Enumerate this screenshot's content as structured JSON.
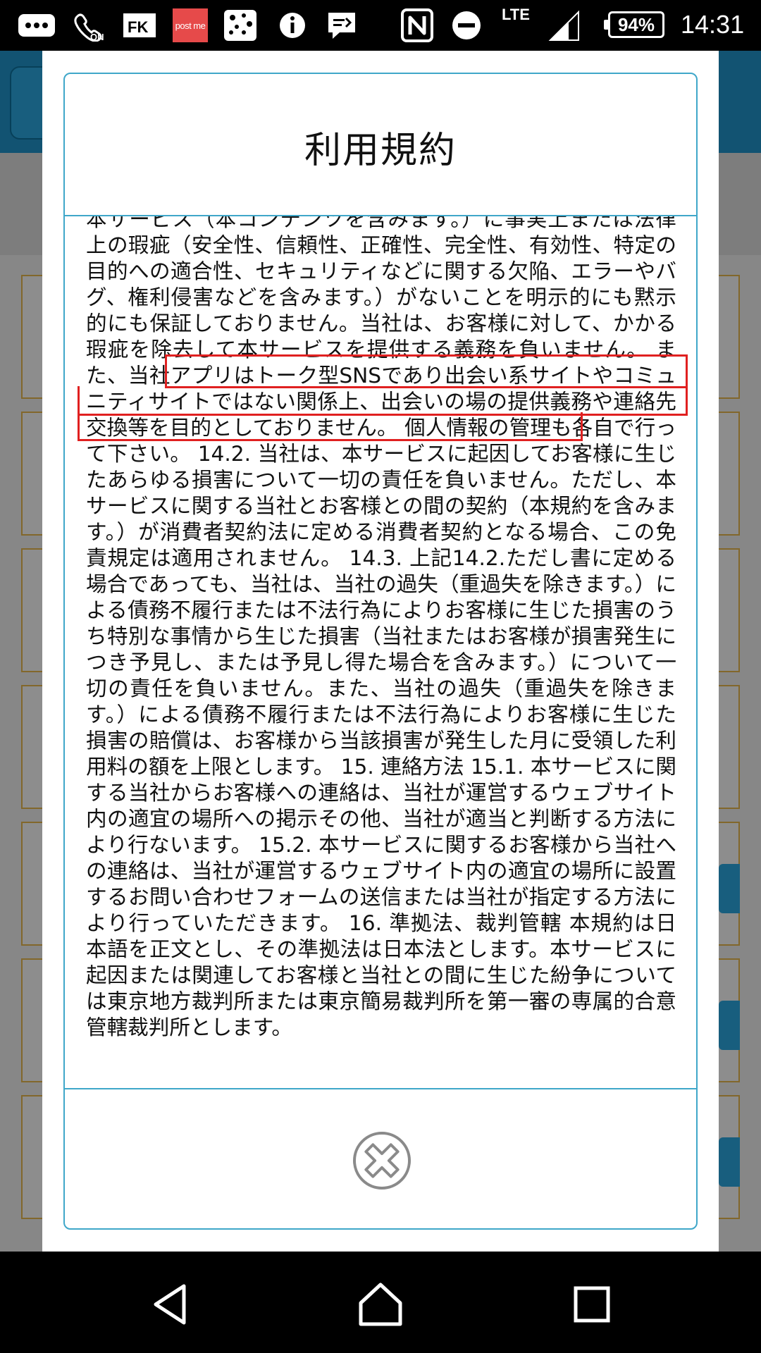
{
  "status_bar": {
    "notif_icons": [
      "more-dots-icon",
      "wifi-calling-icon",
      "fk-app-icon",
      "postme-icon",
      "connect-icon",
      "info-icon",
      "message-icon"
    ],
    "postme_label": "post me",
    "nfc_icon": "nfc-icon",
    "dnd_icon": "do-not-disturb-icon",
    "network_label": "LTE",
    "battery": "94%",
    "time": "14:31"
  },
  "modal": {
    "title": "利用規約",
    "body_text": "本サービス（本コンテンツを含みます。）に事実上または法律上の瑕疵（安全性、信頼性、正確性、完全性、有効性、特定の目的への適合性、セキュリティなどに関する欠陥、エラーやバグ、権利侵害などを含みます。）がないことを明示的にも黙示的にも保証しておりません。当社は、お客様に対して、かかる瑕疵を除去して本サービスを提供する義務を負いません。 また、当社アプリはトーク型SNSであり出会い系サイトやコミュニティサイトではない関係上、出会いの場の提供義務や連絡先交換等を目的としておりません。 個人情報の管理も各自で行って下さい。 14.2. 当社は、本サービスに起因してお客様に生じたあらゆる損害について一切の責任を負いません。ただし、本サービスに関する当社とお客様との間の契約（本規約を含みます。）が消費者契約法に定める消費者契約となる場合、この免責規定は適用されません。 14.3. 上記14.2.ただし書に定める場合であっても、当社は、当社の過失（重過失を除きます。）による債務不履行または不法行為によりお客様に生じた損害のうち特別な事情から生じた損害（当社またはお客様が損害発生につき予見し、または予見し得た場合を含みます。）について一切の責任を負いません。また、当社の過失（重過失を除きます。）による債務不履行または不法行為によりお客様に生じた損害の賠償は、お客様から当該損害が発生した月に受領した利用料の額を上限とします。 15. 連絡方法 15.1. 本サービスに関する当社からお客様への連絡は、当社が運営するウェブサイト内の適宜の場所への掲示その他、当社が適当と判断する方法により行ないます。 15.2. 本サービスに関するお客様から当社への連絡は、当社が運営するウェブサイト内の適宜の場所に設置するお問い合わせフォームの送信または当社が指定する方法により行っていただきます。 16. 準拠法、裁判管轄 本規約は日本語を正文とし、その準拠法は日本法とします。本サービスに起因または関連してお客様と当社との間に生じた紛争については東京地方裁判所または東京簡易裁判所を第一審の専属的合意管轄裁判所とします。",
    "close_icon": "close-circle-icon"
  },
  "nav_bar": {
    "back_icon": "back-triangle-icon",
    "home_icon": "home-icon",
    "recents_icon": "recents-square-icon"
  },
  "colors": {
    "modal_border": "#3fa7c9",
    "highlight": "#e02020",
    "app_header": "#1f8fc4"
  }
}
